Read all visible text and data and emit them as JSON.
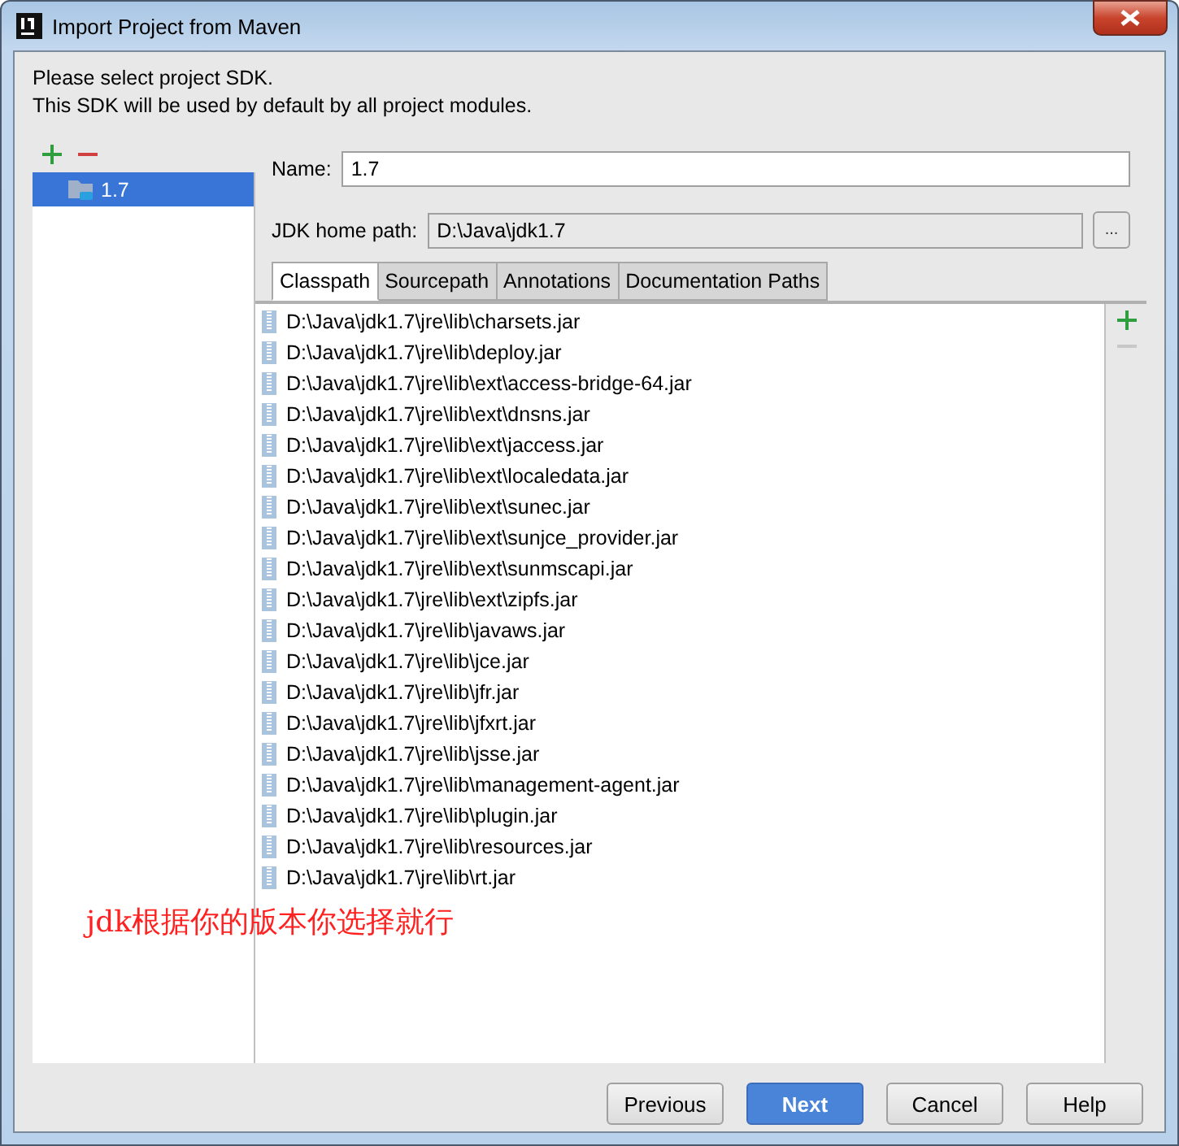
{
  "window": {
    "title": "Import Project from Maven"
  },
  "intro": [
    "Please select project SDK.",
    "This SDK will be used by default by all project modules."
  ],
  "sdk_list": {
    "items": [
      {
        "label": "1.7",
        "selected": true
      }
    ]
  },
  "name_field": {
    "label": "Name:",
    "value": "1.7"
  },
  "home_path": {
    "label": "JDK home path:",
    "value": "D:\\Java\\jdk1.7",
    "browse": "..."
  },
  "tabs": [
    {
      "label": "Classpath",
      "selected": true
    },
    {
      "label": "Sourcepath",
      "selected": false
    },
    {
      "label": "Annotations",
      "selected": false
    },
    {
      "label": "Documentation Paths",
      "selected": false
    }
  ],
  "classpath": [
    "D:\\Java\\jdk1.7\\jre\\lib\\charsets.jar",
    "D:\\Java\\jdk1.7\\jre\\lib\\deploy.jar",
    "D:\\Java\\jdk1.7\\jre\\lib\\ext\\access-bridge-64.jar",
    "D:\\Java\\jdk1.7\\jre\\lib\\ext\\dnsns.jar",
    "D:\\Java\\jdk1.7\\jre\\lib\\ext\\jaccess.jar",
    "D:\\Java\\jdk1.7\\jre\\lib\\ext\\localedata.jar",
    "D:\\Java\\jdk1.7\\jre\\lib\\ext\\sunec.jar",
    "D:\\Java\\jdk1.7\\jre\\lib\\ext\\sunjce_provider.jar",
    "D:\\Java\\jdk1.7\\jre\\lib\\ext\\sunmscapi.jar",
    "D:\\Java\\jdk1.7\\jre\\lib\\ext\\zipfs.jar",
    "D:\\Java\\jdk1.7\\jre\\lib\\javaws.jar",
    "D:\\Java\\jdk1.7\\jre\\lib\\jce.jar",
    "D:\\Java\\jdk1.7\\jre\\lib\\jfr.jar",
    "D:\\Java\\jdk1.7\\jre\\lib\\jfxrt.jar",
    "D:\\Java\\jdk1.7\\jre\\lib\\jsse.jar",
    "D:\\Java\\jdk1.7\\jre\\lib\\management-agent.jar",
    "D:\\Java\\jdk1.7\\jre\\lib\\plugin.jar",
    "D:\\Java\\jdk1.7\\jre\\lib\\resources.jar",
    "D:\\Java\\jdk1.7\\jre\\lib\\rt.jar"
  ],
  "annotation": "jdk根据你的版本你选择就行",
  "buttons": [
    {
      "label": "Previous",
      "default": false
    },
    {
      "label": "Next",
      "default": true
    },
    {
      "label": "Cancel",
      "default": false
    },
    {
      "label": "Help",
      "default": false
    }
  ]
}
